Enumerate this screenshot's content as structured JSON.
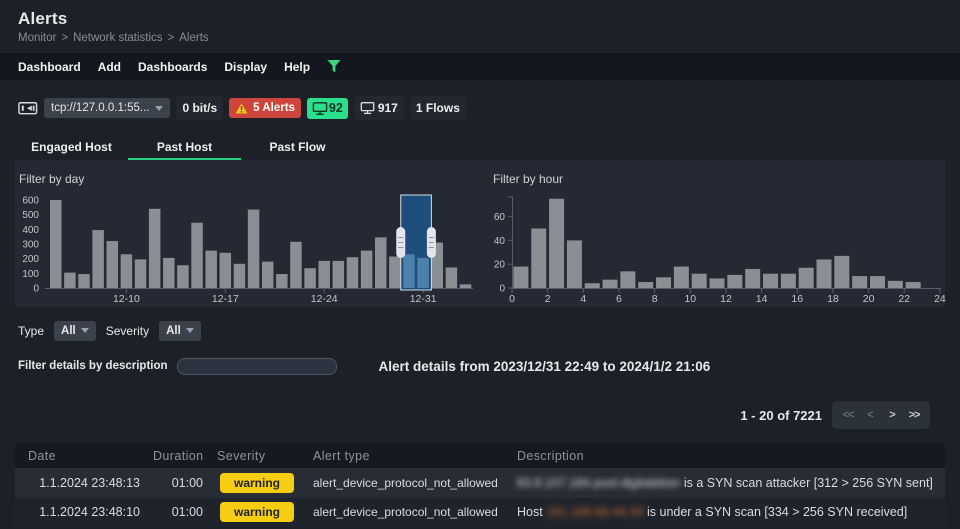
{
  "page": {
    "title": "Alerts",
    "breadcrumb": [
      "Monitor",
      "Network statistics",
      "Alerts"
    ]
  },
  "menu": {
    "items": [
      "Dashboard",
      "Add",
      "Dashboards",
      "Display",
      "Help"
    ],
    "filter_icon_color": "#3ed57f"
  },
  "statusbar": {
    "interface_select": "tcp://127.0.0.1:55...",
    "throughput": "0 bit/s",
    "alerts_badge": {
      "label": "5 Alerts",
      "color": "#ce453c"
    },
    "hosts_badge": {
      "value": "92",
      "color": "#2be08c"
    },
    "devices_count": "917",
    "flows": "1 Flows"
  },
  "tabs": [
    {
      "label": "Engaged Host",
      "active": false
    },
    {
      "label": "Past Host",
      "active": true
    },
    {
      "label": "Past Flow",
      "active": false
    }
  ],
  "filters": {
    "type_label": "Type",
    "type_value": "All",
    "severity_label": "Severity",
    "severity_value": "All"
  },
  "details": {
    "filter_label": "Filter details by description",
    "range_text": "Alert details from 2023/12/31 22:49 to 2024/1/2 21:06"
  },
  "pagination": {
    "range_text": "1 - 20 of 7221",
    "buttons": [
      {
        "label": "<<",
        "disabled": true
      },
      {
        "label": "<",
        "disabled": true
      },
      {
        "label": ">",
        "disabled": false
      },
      {
        "label": ">>",
        "disabled": false
      }
    ]
  },
  "chart_data": [
    {
      "type": "bar",
      "title": "Filter by day",
      "values": [
        600,
        105,
        95,
        395,
        320,
        230,
        195,
        540,
        205,
        155,
        445,
        255,
        240,
        165,
        535,
        180,
        95,
        315,
        135,
        185,
        185,
        210,
        255,
        345,
        215,
        230,
        205,
        310,
        140,
        25
      ],
      "x_ticks": [
        {
          "index": 5,
          "label": "12-10"
        },
        {
          "index": 12,
          "label": "12-17"
        },
        {
          "index": 19,
          "label": "12-24"
        },
        {
          "index": 26,
          "label": "12-31"
        }
      ],
      "yticks": [
        0,
        100,
        200,
        300,
        400,
        500,
        600
      ],
      "ylim": [
        0,
        600
      ],
      "selection": {
        "bar_indices": [
          25,
          26
        ]
      },
      "bar_color": "#8b8e93",
      "selected_bar_color": "#4d80ab",
      "selection_fill": "#1d4e7c"
    },
    {
      "type": "bar",
      "title": "Filter by hour",
      "x": [
        0,
        1,
        2,
        3,
        4,
        5,
        6,
        7,
        8,
        9,
        10,
        11,
        12,
        13,
        14,
        15,
        16,
        17,
        18,
        19,
        20,
        21,
        22,
        23
      ],
      "values": [
        18,
        50,
        75,
        40,
        4,
        7,
        14,
        5,
        9,
        18,
        12,
        8,
        11,
        16,
        12,
        12,
        17,
        24,
        27,
        10,
        10,
        6,
        5,
        0
      ],
      "x_tick_step": 2,
      "yticks": [
        0,
        20,
        40,
        60
      ],
      "ylim": [
        0,
        76
      ],
      "bar_color": "#8b8e93"
    }
  ],
  "table": {
    "columns": [
      "Date",
      "Duration",
      "Severity",
      "Alert type",
      "Description"
    ],
    "rows": [
      {
        "date": "1.1.2024 23:48:13",
        "duration": "01:00",
        "severity": "warning",
        "alert_type": "alert_device_protocol_not_allowed",
        "description": [
          {
            "text": "83.8.107.184.pool.digitalebsn",
            "redacted": true,
            "style": "plain"
          },
          {
            "text": " is a SYN scan attacker [312 > 256 SYN sent]",
            "redacted": false
          }
        ]
      },
      {
        "date": "1.1.2024 23:48:10",
        "duration": "01:00",
        "severity": "warning",
        "alert_type": "alert_device_protocol_not_allowed",
        "description": [
          {
            "text": "Host ",
            "redacted": false
          },
          {
            "text": "191.168.66.44.34",
            "redacted": true,
            "style": "link"
          },
          {
            "text": " is under a SYN scan [334 > 256 SYN received]",
            "redacted": false
          }
        ]
      }
    ]
  }
}
